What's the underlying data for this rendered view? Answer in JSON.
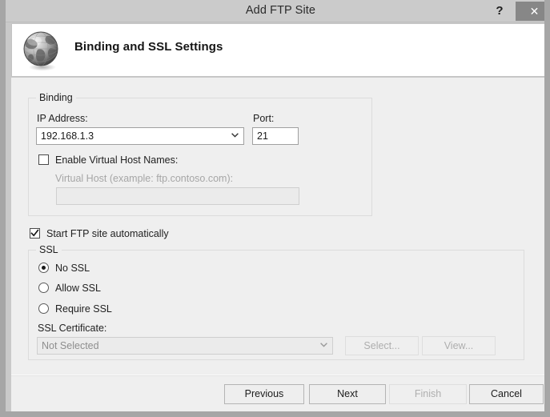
{
  "window": {
    "title": "Add FTP Site",
    "help_label": "?",
    "close_label": "✕"
  },
  "header": {
    "title": "Binding and SSL Settings",
    "icon": "globe-icon"
  },
  "binding": {
    "legend": "Binding",
    "ip_address_label": "IP Address:",
    "ip_address_value": "192.168.1.3",
    "port_label": "Port:",
    "port_value": "21",
    "enable_virtual_host_label": "Enable Virtual Host Names:",
    "enable_virtual_host_checked": false,
    "virtual_host_label": "Virtual Host (example: ftp.contoso.com):",
    "virtual_host_value": "",
    "virtual_host_enabled": false
  },
  "start_ftp": {
    "label": "Start FTP site automatically",
    "checked": true
  },
  "ssl": {
    "legend": "SSL",
    "options": [
      {
        "label": "No SSL",
        "selected": true
      },
      {
        "label": "Allow SSL",
        "selected": false
      },
      {
        "label": "Require SSL",
        "selected": false
      }
    ],
    "certificate_label": "SSL Certificate:",
    "certificate_value": "Not Selected",
    "certificate_enabled": false,
    "select_button": "Select...",
    "select_enabled": false,
    "view_button": "View...",
    "view_enabled": false
  },
  "footer": {
    "previous": "Previous",
    "next": "Next",
    "finish": "Finish",
    "cancel": "Cancel",
    "finish_enabled": false
  },
  "colors": {
    "window_frame": "#a6a6a6",
    "titlebar": "#cbcbcb",
    "close_button": "#878787",
    "body": "#efefef",
    "header": "#ffffff",
    "groupbox_border": "#dcdcdc",
    "text": "#1f1f1f",
    "disabled_text": "#a6a6a6"
  }
}
